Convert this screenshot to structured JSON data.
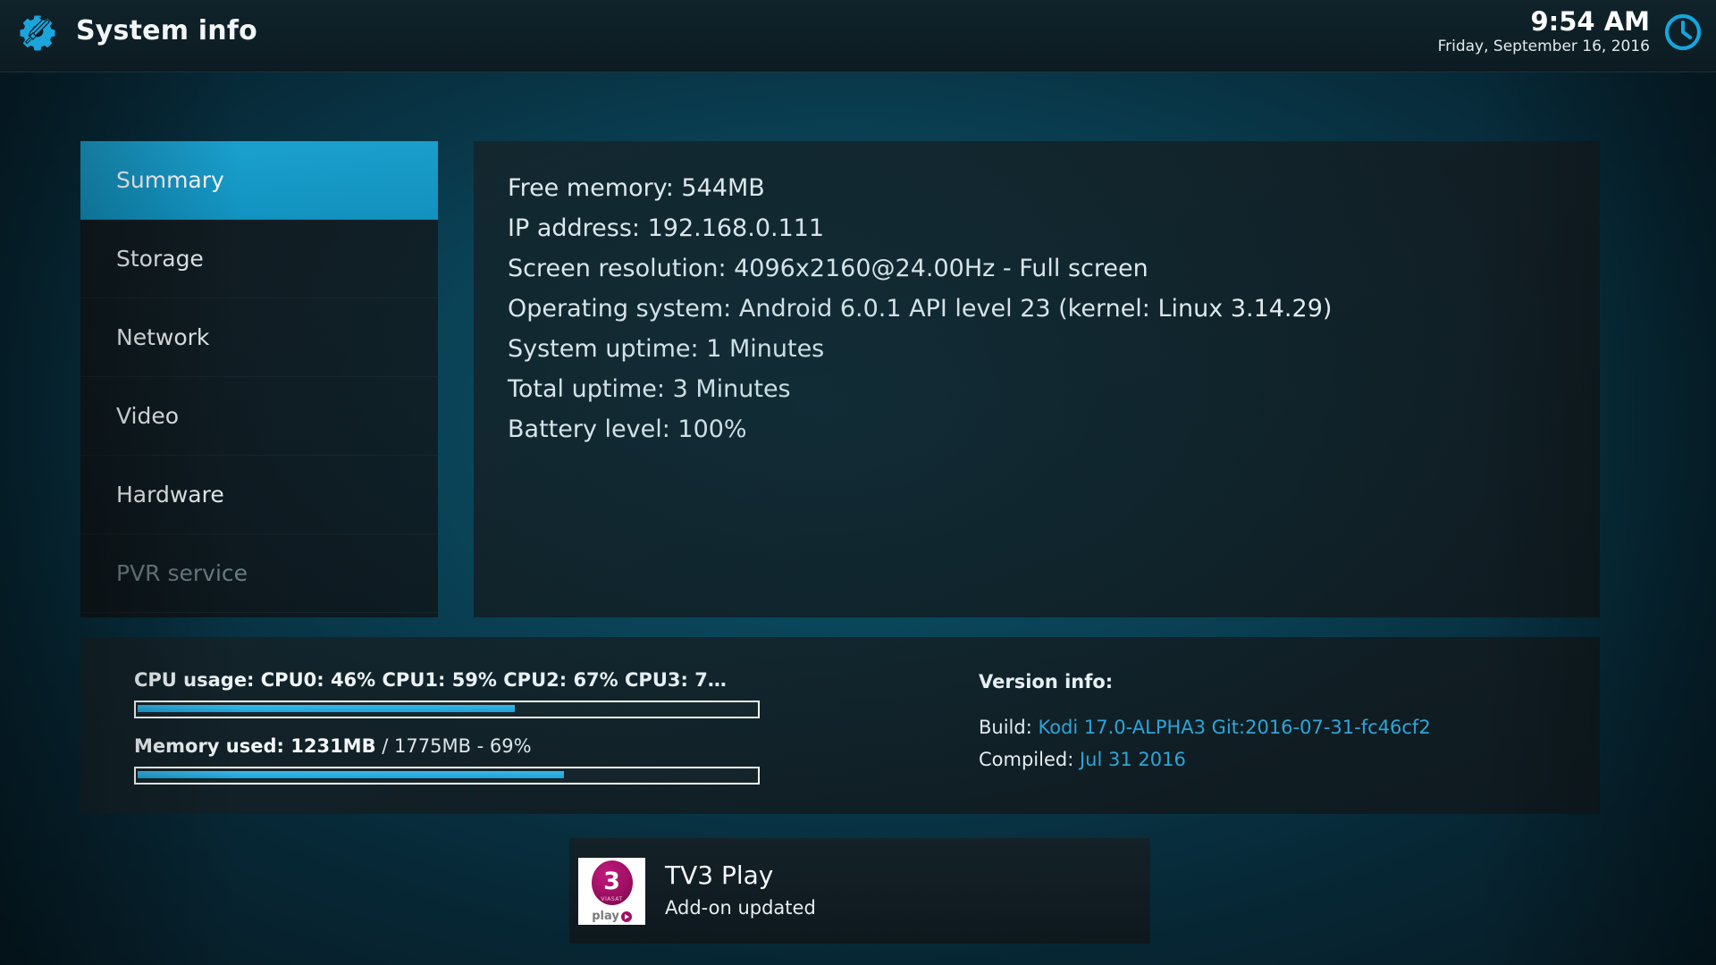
{
  "header": {
    "title": "System info",
    "app_icon": "settings-gear-screwdriver-icon",
    "clock_icon": "clock-icon",
    "time": "9:54 AM",
    "date": "Friday, September 16, 2016"
  },
  "sidebar": {
    "items": [
      {
        "label": "Summary",
        "selected": true,
        "dimmed": false
      },
      {
        "label": "Storage",
        "selected": false,
        "dimmed": false
      },
      {
        "label": "Network",
        "selected": false,
        "dimmed": false
      },
      {
        "label": "Video",
        "selected": false,
        "dimmed": false
      },
      {
        "label": "Hardware",
        "selected": false,
        "dimmed": false
      },
      {
        "label": "PVR service",
        "selected": false,
        "dimmed": true
      }
    ]
  },
  "main": {
    "lines": [
      "Free memory: 544MB",
      "IP address: 192.168.0.111",
      "Screen resolution: 4096x2160@24.00Hz - Full screen",
      "Operating system: Android 6.0.1 API level 23 (kernel: Linux 3.14.29)",
      "System uptime: 1 Minutes",
      "Total uptime: 3 Minutes",
      "Battery level: 100%"
    ]
  },
  "bottom": {
    "cpu": {
      "label": "CPU usage: CPU0:  46% CPU1:  59% CPU2:  67% CPU3:  7…",
      "percent": 61,
      "cores": [
        {
          "name": "CPU0",
          "percent": 46
        },
        {
          "name": "CPU1",
          "percent": 59
        },
        {
          "name": "CPU2",
          "percent": 67
        },
        {
          "name": "CPU3",
          "percent": 7
        }
      ]
    },
    "memory": {
      "label_bold": "Memory used: 1231MB",
      "label_rest": " / 1775MB - 69%",
      "used_mb": 1231,
      "total_mb": 1775,
      "percent": 69
    },
    "version": {
      "title": "Version info:",
      "build_label": "Build: ",
      "build_value": "Kodi 17.0-ALPHA3 Git:2016-07-31-fc46cf2",
      "compiled_label": "Compiled: ",
      "compiled_value": "Jul 31 2016"
    }
  },
  "notification": {
    "icon": "tv3-play-logo-icon",
    "logo_number": "3",
    "logo_brand": "VIASAT",
    "logo_play_text": "play",
    "title": "TV3 Play",
    "subtitle": "Add-on updated"
  },
  "colors": {
    "accent": "#1294c2",
    "link": "#2fa6d8",
    "bar_fill": "#1ea3d8",
    "panel": "#121f25",
    "text": "#eef4f6",
    "dim_text": "#6d7d83",
    "logo_magenta": "#a01068"
  }
}
